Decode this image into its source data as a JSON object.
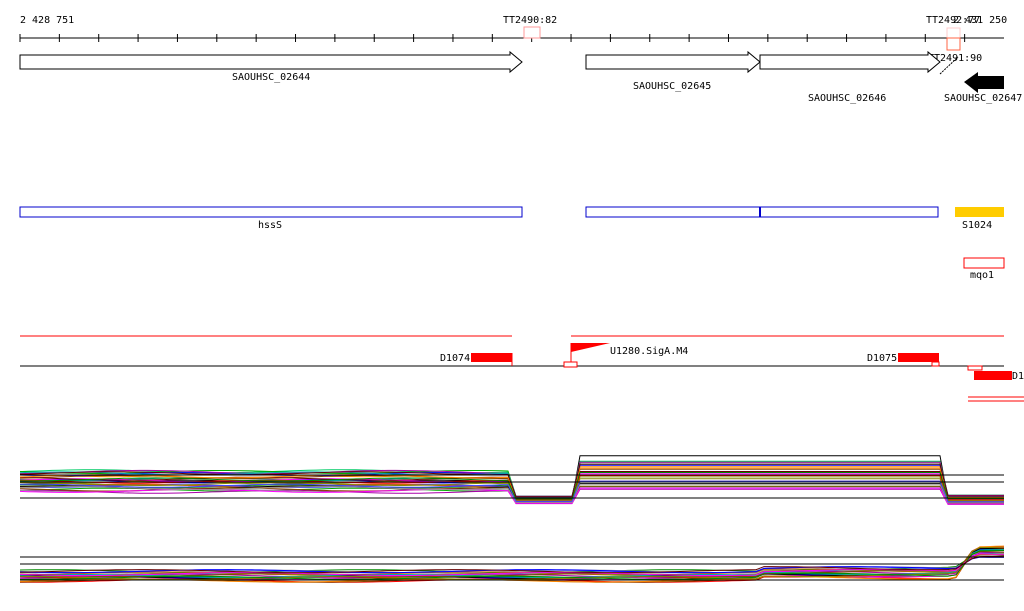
{
  "ruler": {
    "start": "2 428 751",
    "end": "2 431 250"
  },
  "terminators": [
    {
      "label": "TT2490:82"
    },
    {
      "label": "TT2492:77"
    },
    {
      "label": "TT2491:90"
    }
  ],
  "genes": [
    {
      "label": "SAOUHSC_02644",
      "strand": "+"
    },
    {
      "label": "SAOUHSC_02645",
      "strand": "+"
    },
    {
      "label": "SAOUHSC_02646",
      "strand": "+"
    },
    {
      "label": "SAOUHSC_02647",
      "strand": "-"
    }
  ],
  "operons": [
    {
      "label": "hssS"
    },
    {
      "label": "S1024"
    },
    {
      "label": "mqo1"
    }
  ],
  "segments": [
    {
      "label": "D1074"
    },
    {
      "label": "U1280.SigA.M4"
    },
    {
      "label": "D1075"
    },
    {
      "label": "D1"
    }
  ],
  "colors": {
    "accent": "#ff0000",
    "operon": "#0000cc",
    "s1024": "#ffcc00"
  }
}
